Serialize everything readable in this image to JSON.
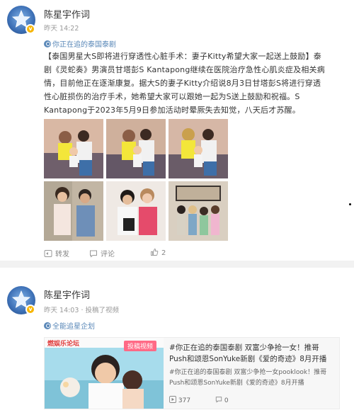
{
  "post1": {
    "username": "陈星宇作词",
    "time": "昨天 14:22",
    "topic": "你正在追的泰国泰剧",
    "body": "【泰国男星大S即将进行穿透性心脏手术：妻子Kitty希望大家一起送上鼓励】泰剧《灵蛇奏》男演员甘塔彭S Kantapong继续在医院治疗急性心肌炎症及相关病情，目前他正在逐渐康复。据大S的妻子Kitty介绍说8月3日甘塔彭S将进行穿透性心脏损伤的治疗手术，她希望大家可以跟她一起为S送上鼓励和祝福。S Kantapong于2023年5月9日参加活动时晕厥失去知觉，八天后才苏醒。",
    "actions": {
      "repost": "转发",
      "comment": "评论",
      "like_count": "2"
    }
  },
  "post2": {
    "username": "陈星宇作词",
    "time": "昨天 14:03",
    "source": "投稿了视频",
    "topic": "全能追星企划",
    "video": {
      "badge": "投稿视频",
      "brand": "燃娱乐论坛",
      "title": "#你正在追的泰国泰剧 双富少争抢一女！推哥Push和颂恩SonYuke新剧《爱的奇迹》8月开播",
      "subtitle": "#你正在追的泰国泰剧 双富少争抢一女pooklook！推哥Push和颂恩SonYuke新剧《爱的奇迹》8月开播",
      "plays": "377",
      "comments": "0"
    }
  },
  "colors": {
    "link": "#5a88b8",
    "vip": "#f7b500"
  },
  "icons": [
    "star-logo-icon",
    "vip-badge-icon",
    "topic-icon",
    "repost-icon",
    "comment-icon",
    "like-icon",
    "play-icon"
  ]
}
